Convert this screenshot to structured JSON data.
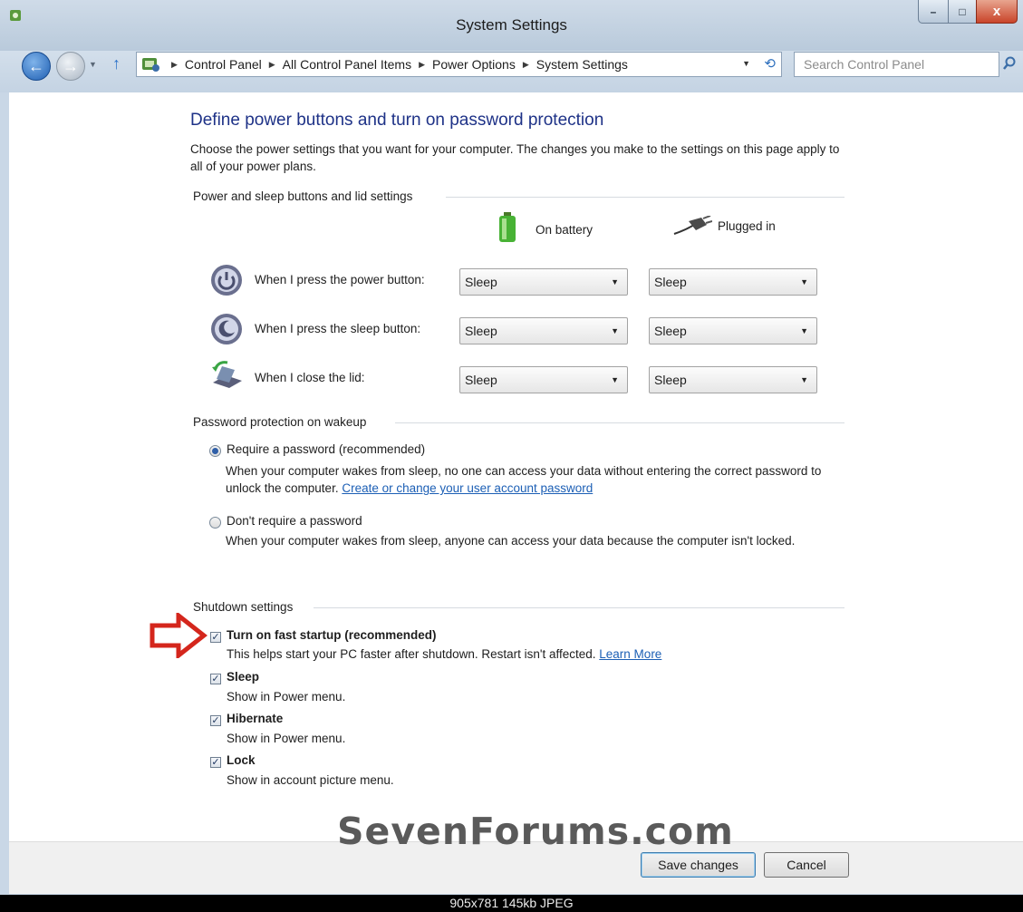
{
  "window": {
    "title": "System Settings",
    "minimize": "–",
    "maximize": "□",
    "close": "x"
  },
  "nav": {
    "breadcrumbs": [
      "Control Panel",
      "All Control Panel Items",
      "Power Options",
      "System Settings"
    ],
    "search_placeholder": "Search Control Panel"
  },
  "page": {
    "heading": "Define power buttons and turn on password protection",
    "description": "Choose the power settings that you want for your computer. The changes you make to the settings on this page apply to all of your power plans."
  },
  "power_group": {
    "title": "Power and sleep buttons and lid settings",
    "col_battery": "On battery",
    "col_plugged": "Plugged in",
    "rows": [
      {
        "label": "When I press the power button:",
        "battery": "Sleep",
        "plugged": "Sleep",
        "icon": "power-button-icon"
      },
      {
        "label": "When I press the sleep button:",
        "battery": "Sleep",
        "plugged": "Sleep",
        "icon": "sleep-button-icon"
      },
      {
        "label": "When I close the lid:",
        "battery": "Sleep",
        "plugged": "Sleep",
        "icon": "laptop-lid-icon"
      }
    ]
  },
  "password_group": {
    "title": "Password protection on wakeup",
    "require_label": "Require a password (recommended)",
    "require_desc": "When your computer wakes from sleep, no one can access your data without entering the correct password to unlock the computer.",
    "require_link": "Create or change your user account password",
    "require_selected": true,
    "norequire_label": "Don't require a password",
    "norequire_desc": "When your computer wakes from sleep, anyone can access your data because the computer isn't locked."
  },
  "shutdown_group": {
    "title": "Shutdown settings",
    "fast_startup_label": "Turn on fast startup (recommended)",
    "fast_startup_desc": "This helps start your PC faster after shutdown. Restart isn't affected.",
    "fast_startup_link": "Learn More",
    "sleep_label": "Sleep",
    "sleep_desc": "Show in Power menu.",
    "hibernate_label": "Hibernate",
    "hibernate_desc": "Show in Power menu.",
    "lock_label": "Lock",
    "lock_desc": "Show in account picture menu.",
    "checked": [
      true,
      true,
      true,
      true
    ]
  },
  "watermark": "SevenForums.com",
  "buttons": {
    "save": "Save changes",
    "cancel": "Cancel"
  },
  "caption": "905x781  145kb  JPEG",
  "colors": {
    "heading": "#1e3287",
    "link": "#1c5fb5",
    "arrow": "#d4261c",
    "frame": "#c9d7e6"
  }
}
